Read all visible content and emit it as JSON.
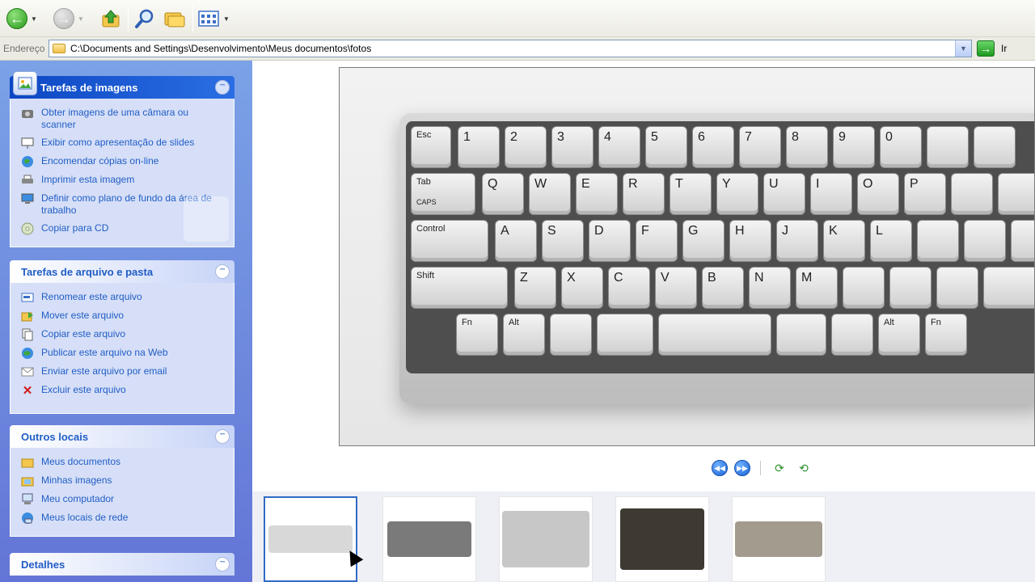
{
  "toolbar": {
    "buttons": [
      {
        "name": "back",
        "icon": "back-arrow-icon"
      },
      {
        "name": "forward",
        "icon": "forward-arrow-icon"
      },
      {
        "name": "up",
        "icon": "up-folder-icon"
      },
      {
        "name": "search",
        "icon": "search-icon"
      },
      {
        "name": "folders",
        "icon": "folders-icon"
      },
      {
        "name": "views",
        "icon": "views-icon"
      }
    ]
  },
  "address": {
    "label": "Endereço",
    "path": "C:\\Documents and Settings\\Desenvolvimento\\Meus documentos\\fotos",
    "go_label": "Ir"
  },
  "tasks": {
    "image_tasks": {
      "title": "Tarefas de imagens",
      "items": [
        {
          "label": "Obter imagens de uma câmara ou scanner",
          "icon": "camera-icon"
        },
        {
          "label": "Exibir como apresentação de slides",
          "icon": "slideshow-icon"
        },
        {
          "label": "Encomendar cópias on-line",
          "icon": "globe-icon"
        },
        {
          "label": "Imprimir esta imagem",
          "icon": "printer-icon"
        },
        {
          "label": "Definir como plano de fundo da área de trabalho",
          "icon": "desktop-icon"
        },
        {
          "label": "Copiar para CD",
          "icon": "cd-icon"
        }
      ]
    },
    "file_tasks": {
      "title": "Tarefas de arquivo e pasta",
      "items": [
        {
          "label": "Renomear este arquivo",
          "icon": "rename-icon"
        },
        {
          "label": "Mover este arquivo",
          "icon": "move-icon"
        },
        {
          "label": "Copiar este arquivo",
          "icon": "copy-icon"
        },
        {
          "label": "Publicar este arquivo na Web",
          "icon": "publish-icon"
        },
        {
          "label": "Enviar este arquivo por email",
          "icon": "email-icon"
        },
        {
          "label": "Excluir este arquivo",
          "icon": "delete-icon"
        }
      ]
    },
    "other_places": {
      "title": "Outros locais",
      "items": [
        {
          "label": "Meus documentos",
          "icon": "folder-icon"
        },
        {
          "label": "Minhas imagens",
          "icon": "pictures-folder-icon"
        },
        {
          "label": "Meu computador",
          "icon": "computer-icon"
        },
        {
          "label": "Meus locais de rede",
          "icon": "network-icon"
        }
      ]
    },
    "details": {
      "title": "Detalhes"
    }
  },
  "preview": {
    "keys": {
      "esc": "Esc",
      "tab": "Tab",
      "control": "Control",
      "shift": "Shift",
      "fn": "Fn",
      "alt": "Alt",
      "caps": "CAPS",
      "nums": [
        "1",
        "2",
        "3",
        "4",
        "5",
        "6",
        "7",
        "8",
        "9",
        "0"
      ],
      "row_q": [
        "Q",
        "W",
        "E",
        "R",
        "T",
        "Y",
        "U",
        "I",
        "O",
        "P"
      ],
      "row_a": [
        "A",
        "S",
        "D",
        "F",
        "G",
        "H",
        "J",
        "K",
        "L"
      ],
      "row_z": [
        "Z",
        "X",
        "C",
        "V",
        "B",
        "N",
        "M"
      ]
    }
  },
  "filmstrip": {
    "thumbnails": [
      {
        "selected": true,
        "color": "#d8d8d8"
      },
      {
        "selected": false,
        "color": "#7a7a7a"
      },
      {
        "selected": false,
        "color": "#c7c7c7"
      },
      {
        "selected": false,
        "color": "#3e3a32"
      },
      {
        "selected": false,
        "color": "#a39c8e"
      }
    ]
  }
}
